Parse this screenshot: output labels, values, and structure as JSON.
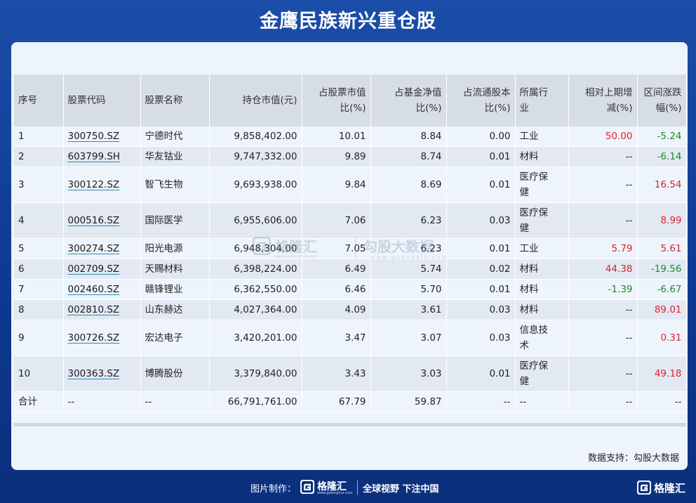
{
  "title": "金鹰民族新兴重仓股",
  "table": {
    "headers": [
      {
        "l1": "序号",
        "l2": ""
      },
      {
        "l1": "股票代码",
        "l2": ""
      },
      {
        "l1": "股票名称",
        "l2": ""
      },
      {
        "l1": "持仓市值(元)",
        "l2": ""
      },
      {
        "l1": "占股票市值",
        "l2": "比(%)"
      },
      {
        "l1": "占基金净值",
        "l2": "比(%)"
      },
      {
        "l1": "占流通股本",
        "l2": "比(%)"
      },
      {
        "l1": "所属行",
        "l2": "业"
      },
      {
        "l1": "相对上期增",
        "l2": "减(%)"
      },
      {
        "l1": "区间涨跌",
        "l2": "幅(%)"
      }
    ],
    "rows": [
      {
        "no": "1",
        "code": "300750.SZ",
        "name": "宁德时代",
        "value": "9,858,402.00",
        "stock_pct": "10.01",
        "nav_pct": "8.84",
        "float_pct": "0.00",
        "ind1": "工业",
        "ind2": "",
        "change": "50.00",
        "change_color": "#e0212b",
        "range": "-5.24",
        "range_color": "#1a8c2a"
      },
      {
        "no": "2",
        "code": "603799.SH",
        "name": "华友钴业",
        "value": "9,747,332.00",
        "stock_pct": "9.89",
        "nav_pct": "8.74",
        "float_pct": "0.01",
        "ind1": "材料",
        "ind2": "",
        "change": "--",
        "change_color": "#222222",
        "range": "-6.14",
        "range_color": "#1a8c2a"
      },
      {
        "no": "3",
        "code": "300122.SZ",
        "name": "智飞生物",
        "value": "9,693,938.00",
        "stock_pct": "9.84",
        "nav_pct": "8.69",
        "float_pct": "0.01",
        "ind1": "医疗保",
        "ind2": "健",
        "change": "--",
        "change_color": "#222222",
        "range": "16.54",
        "range_color": "#e0212b"
      },
      {
        "no": "4",
        "code": "000516.SZ",
        "name": "国际医学",
        "value": "6,955,606.00",
        "stock_pct": "7.06",
        "nav_pct": "6.23",
        "float_pct": "0.03",
        "ind1": "医疗保",
        "ind2": "健",
        "change": "--",
        "change_color": "#222222",
        "range": "8.99",
        "range_color": "#e0212b"
      },
      {
        "no": "5",
        "code": "300274.SZ",
        "name": "阳光电源",
        "value": "6,948,304.00",
        "stock_pct": "7.05",
        "nav_pct": "6.23",
        "float_pct": "0.01",
        "ind1": "工业",
        "ind2": "",
        "change": "5.79",
        "change_color": "#e0212b",
        "range": "5.61",
        "range_color": "#e0212b"
      },
      {
        "no": "6",
        "code": "002709.SZ",
        "name": "天赐材料",
        "value": "6,398,224.00",
        "stock_pct": "6.49",
        "nav_pct": "5.74",
        "float_pct": "0.02",
        "ind1": "材料",
        "ind2": "",
        "change": "44.38",
        "change_color": "#e0212b",
        "range": "-19.56",
        "range_color": "#1a8c2a"
      },
      {
        "no": "7",
        "code": "002460.SZ",
        "name": "赣锋锂业",
        "value": "6,362,550.00",
        "stock_pct": "6.46",
        "nav_pct": "5.70",
        "float_pct": "0.01",
        "ind1": "材料",
        "ind2": "",
        "change": "-1.39",
        "change_color": "#1a8c2a",
        "range": "-6.67",
        "range_color": "#1a8c2a"
      },
      {
        "no": "8",
        "code": "002810.SZ",
        "name": "山东赫达",
        "value": "4,027,364.00",
        "stock_pct": "4.09",
        "nav_pct": "3.61",
        "float_pct": "0.03",
        "ind1": "材料",
        "ind2": "",
        "change": "--",
        "change_color": "#222222",
        "range": "89.01",
        "range_color": "#e0212b"
      },
      {
        "no": "9",
        "code": "300726.SZ",
        "name": "宏达电子",
        "value": "3,420,201.00",
        "stock_pct": "3.47",
        "nav_pct": "3.07",
        "float_pct": "0.03",
        "ind1": "信息技",
        "ind2": "术",
        "change": "--",
        "change_color": "#222222",
        "range": "0.31",
        "range_color": "#e0212b"
      },
      {
        "no": "10",
        "code": "300363.SZ",
        "name": "博腾股份",
        "value": "3,379,840.00",
        "stock_pct": "3.43",
        "nav_pct": "3.03",
        "float_pct": "0.01",
        "ind1": "医疗保",
        "ind2": "健",
        "change": "--",
        "change_color": "#222222",
        "range": "49.18",
        "range_color": "#e0212b"
      }
    ],
    "total": {
      "no": "合计",
      "code": "--",
      "name": "--",
      "value": "66,791,761.00",
      "stock_pct": "67.79",
      "nav_pct": "59.87",
      "float_pct": "--",
      "ind": "--",
      "change": "--",
      "range": "--"
    }
  },
  "source": "数据支持：勾股大数据",
  "watermark": {
    "brand": "格隆汇",
    "brand_url": "www.gelonghui.com",
    "partner": "勾股大数据",
    "partner_url": "www.gogudata.com"
  },
  "footer": {
    "made_by": "图片制作：",
    "logo_text": "格隆汇",
    "logo_sub": "www.gelonghui.com",
    "slogan": "全球视野 下注中国",
    "corner_logo": "格隆汇"
  },
  "colors": {
    "up": "#e0212b",
    "down": "#1a8c2a",
    "header_bg": "#d7dde7",
    "frame": "#0e3a92"
  }
}
